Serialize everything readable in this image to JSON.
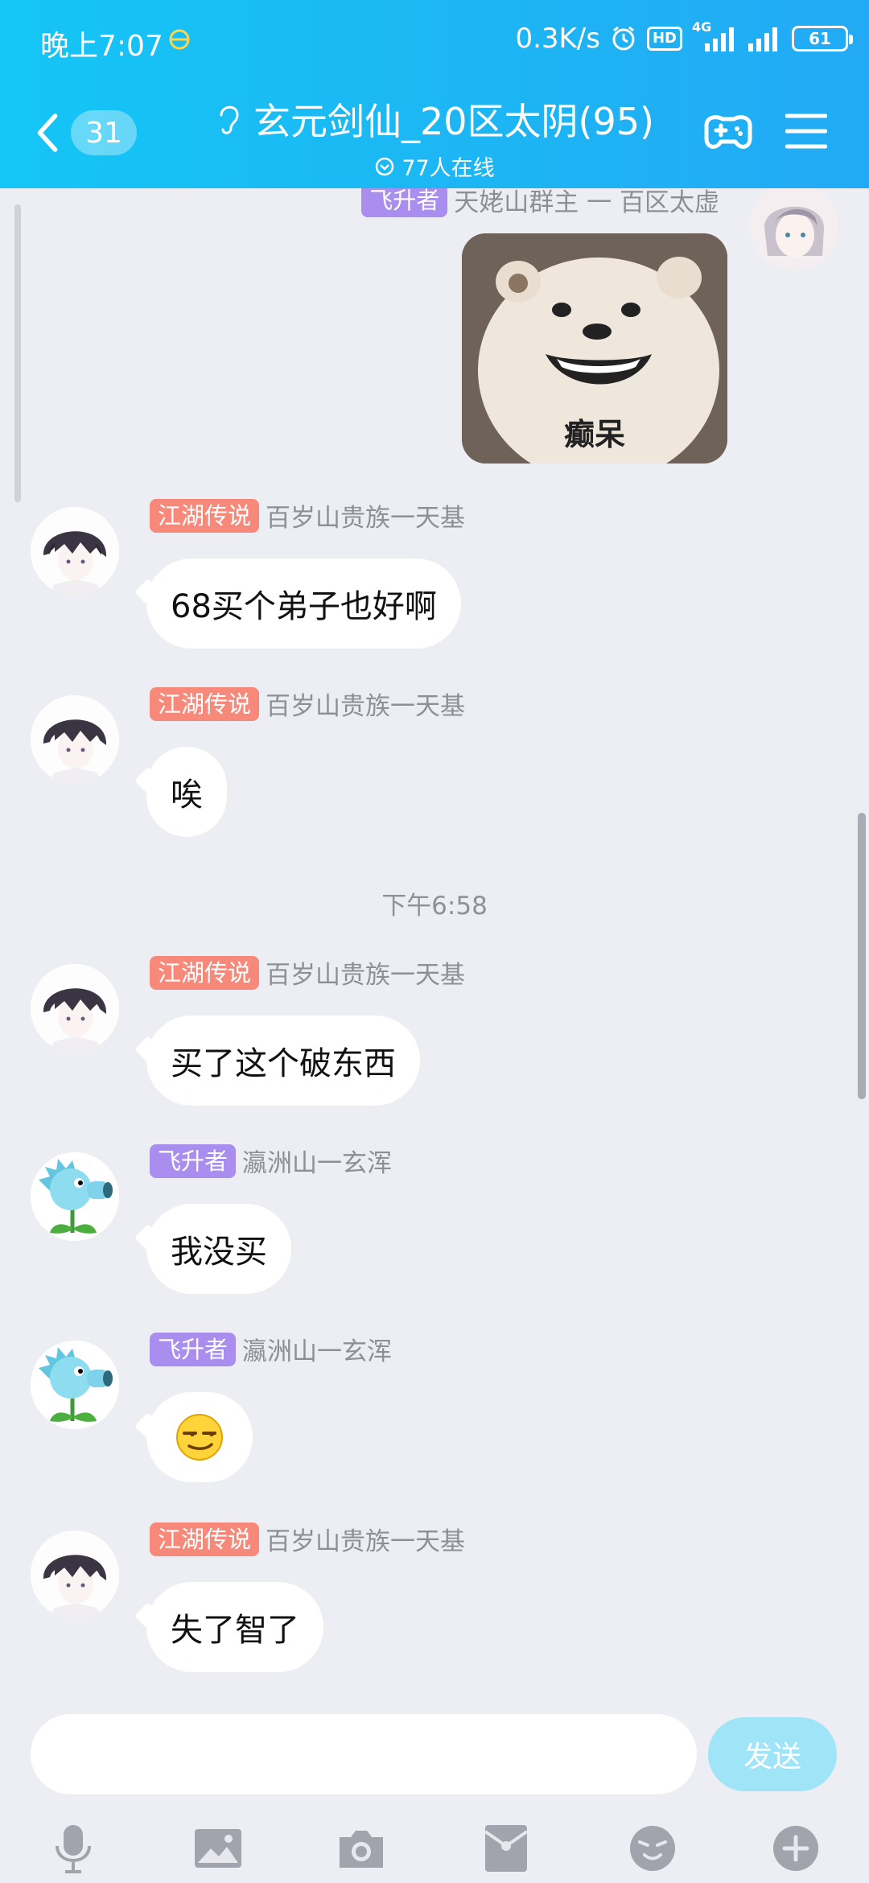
{
  "status_bar": {
    "time": "晚上7:07",
    "net_speed": "0.3K/s",
    "hd": "HD",
    "signal_label": "4G",
    "battery": "61"
  },
  "header": {
    "unread_count": "31",
    "group_name": "玄元剑仙_20区太阴(95)",
    "online_text": "77人在线"
  },
  "messages": [
    {
      "tag": "飞升者",
      "sender": "天姥山群主 一 百区太虚",
      "type": "sticker",
      "sticker_text": "癫呆"
    },
    {
      "tag": "江湖传说",
      "sender": "百岁山贵族一天基",
      "text": "68买个弟子也好啊"
    },
    {
      "tag": "江湖传说",
      "sender": "百岁山贵族一天基",
      "text": "唉"
    },
    {
      "timestamp": "下午6:58"
    },
    {
      "tag": "江湖传说",
      "sender": "百岁山贵族一天基",
      "text": "买了这个破东西"
    },
    {
      "tag": "飞升者",
      "sender": "瀛洲山一玄浑",
      "text": "我没买"
    },
    {
      "tag": "飞升者",
      "sender": "瀛洲山一玄浑",
      "type": "emoji",
      "text": ""
    },
    {
      "tag": "江湖传说",
      "sender": "百岁山贵族一天基",
      "text": "失了智了"
    }
  ],
  "input": {
    "placeholder": "",
    "send_label": "发送"
  },
  "toolbar": [
    "microphone-icon",
    "image-icon",
    "camera-icon",
    "red-packet-icon",
    "emoji-icon",
    "plus-icon"
  ],
  "colors": {
    "header_start": "#14c6f5",
    "header_end": "#22aaf5",
    "tag_legend": "#f6897a",
    "tag_ascended": "#a98ef0",
    "send_button": "#9fe4f7",
    "background": "#eceef4"
  }
}
